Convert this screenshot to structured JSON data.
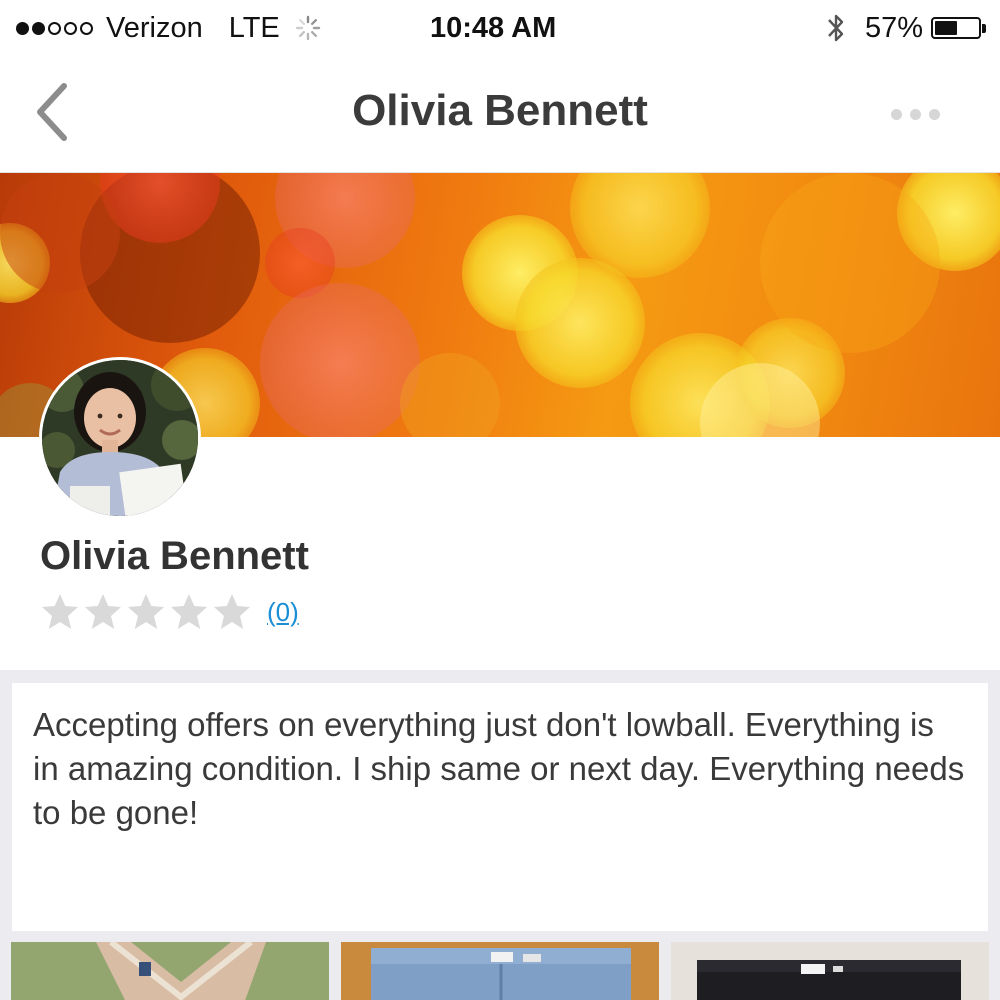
{
  "status_bar": {
    "carrier": "Verizon",
    "network": "LTE",
    "time": "10:48 AM",
    "battery_percent": "57%",
    "battery_level": 0.57,
    "signal_bars_filled": 2,
    "signal_bars_total": 5,
    "icons": [
      "signal-dots-icon",
      "activity-spinner-icon",
      "bluetooth-icon",
      "battery-icon"
    ]
  },
  "nav": {
    "title": "Olivia Bennett",
    "back_icon": "chevron-left-icon",
    "more_icon": "ellipsis-icon"
  },
  "profile": {
    "name": "Olivia Bennett",
    "rating_stars": 0,
    "rating_max": 5,
    "review_count": "(0)",
    "cover_image": "orange-yellow-bokeh-lights",
    "avatar_image": "profile-photo"
  },
  "bio": {
    "text": "Accepting offers on everything just don't lowball. Everything is in amazing condition. I ship same or next day. Everything needs to be gone!"
  },
  "listings": [
    {
      "thumbnail": "beige-lace-top-photo"
    },
    {
      "thumbnail": "denim-jeans-photo"
    },
    {
      "thumbnail": "black-jeans-photo"
    }
  ],
  "colors": {
    "link": "#1a8fd6",
    "title_text": "#3b3b3b",
    "body_text": "#3a3a3a",
    "star_empty": "#d9d9d9",
    "background_gray": "#ececf0"
  }
}
